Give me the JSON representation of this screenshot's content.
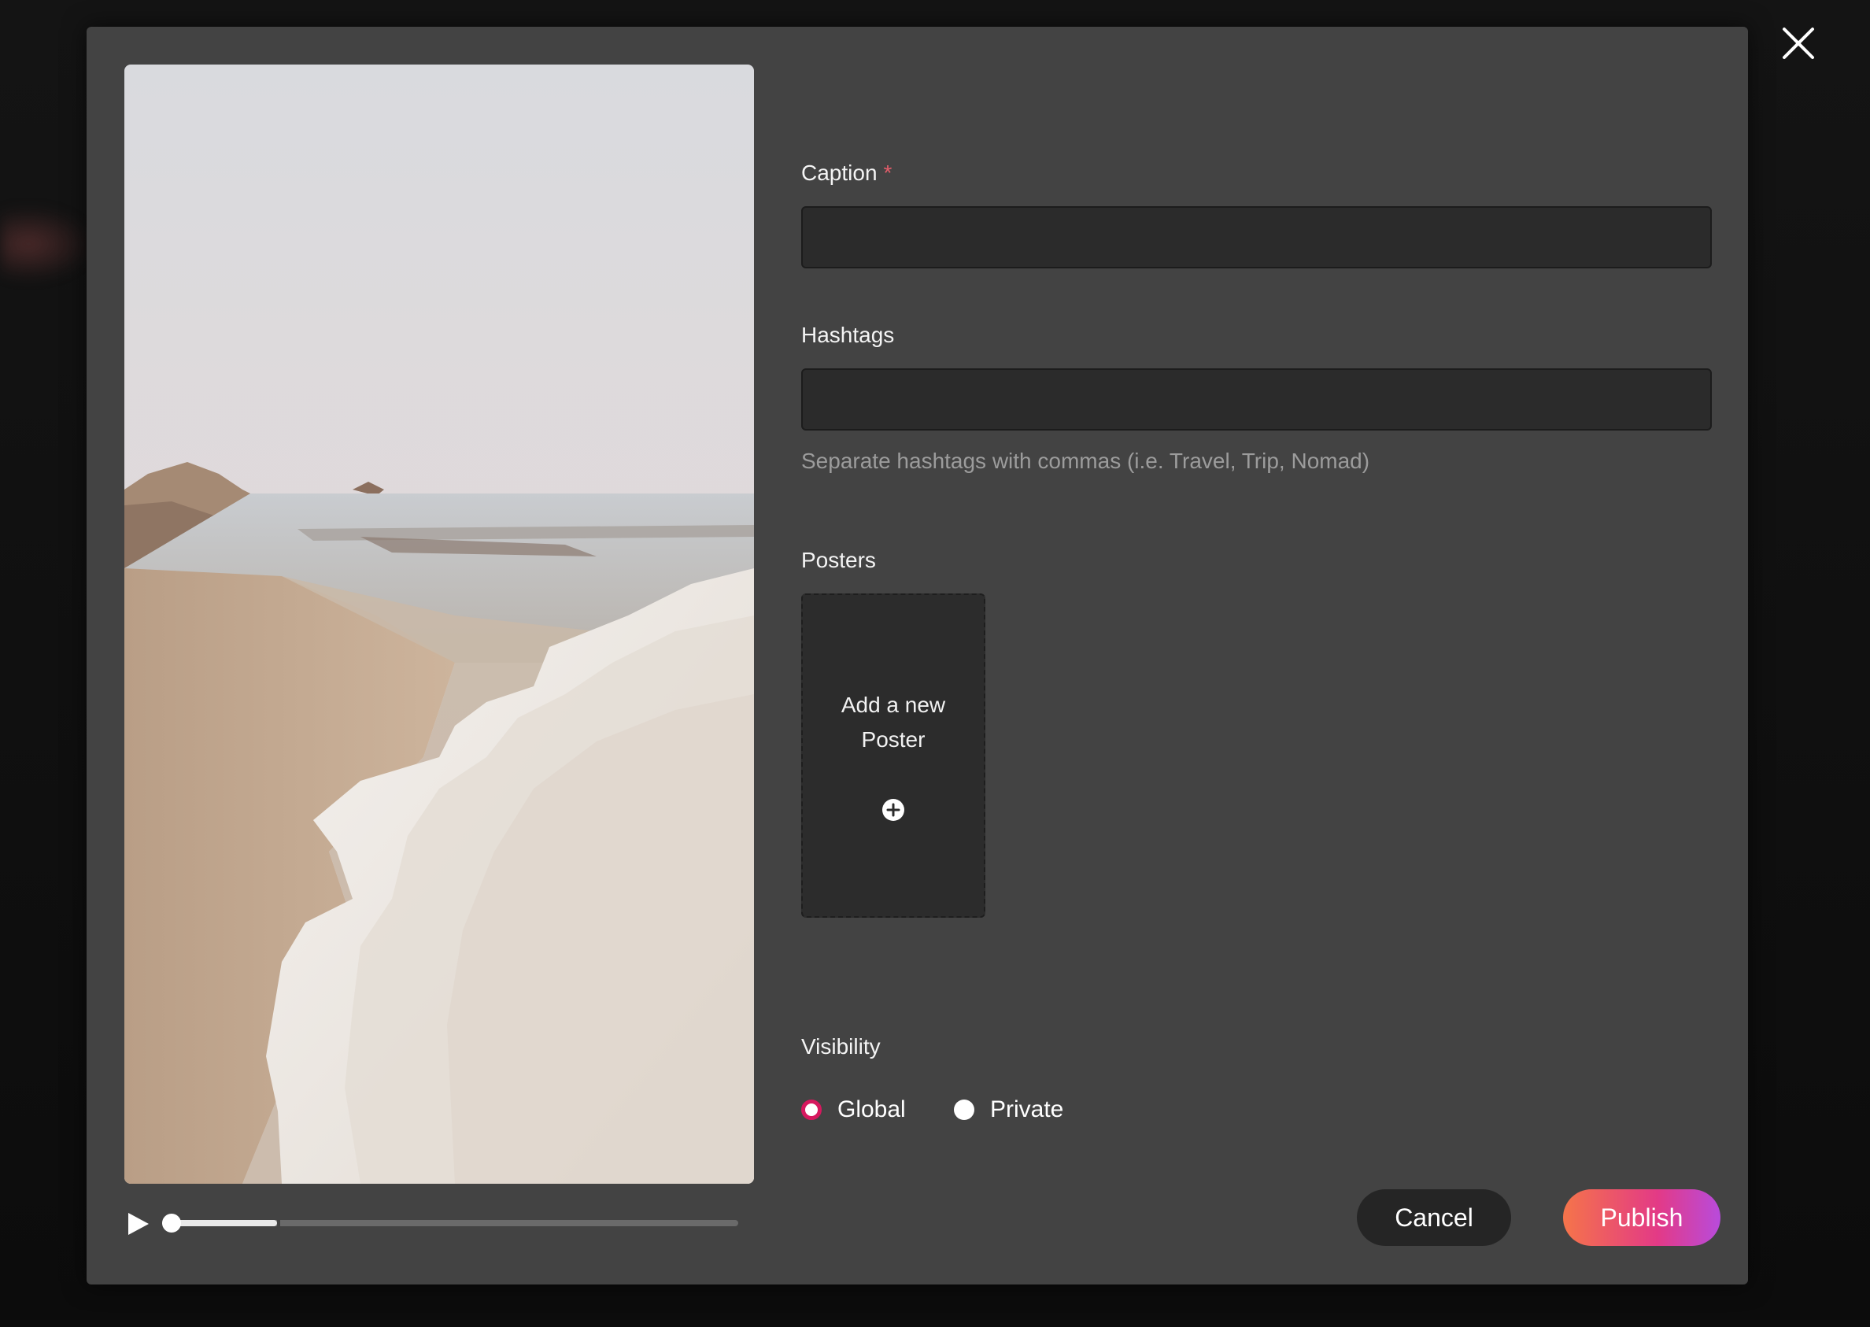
{
  "modal": {
    "caption": {
      "label": "Caption",
      "required_marker": "*",
      "value": "",
      "placeholder": ""
    },
    "hashtags": {
      "label": "Hashtags",
      "value": "",
      "placeholder": "",
      "helper": "Separate hashtags with commas (i.e. Travel, Trip, Nomad)"
    },
    "posters": {
      "label": "Posters",
      "add_line1": "Add a new",
      "add_line2": "Poster",
      "add_icon": "plus-circle-icon"
    },
    "visibility": {
      "label": "Visibility",
      "options": [
        {
          "label": "Global",
          "checked": true
        },
        {
          "label": "Private",
          "checked": false
        }
      ]
    },
    "player": {
      "progress": 0.2
    },
    "actions": {
      "cancel": "Cancel",
      "publish": "Publish"
    },
    "close_icon": "close-icon"
  },
  "colors": {
    "accent_radio": "#d6185e",
    "publish_gradient_start": "#f5744a",
    "publish_gradient_end": "#b84bdc",
    "modal_bg": "#434343",
    "input_bg": "#2b2b2b"
  }
}
